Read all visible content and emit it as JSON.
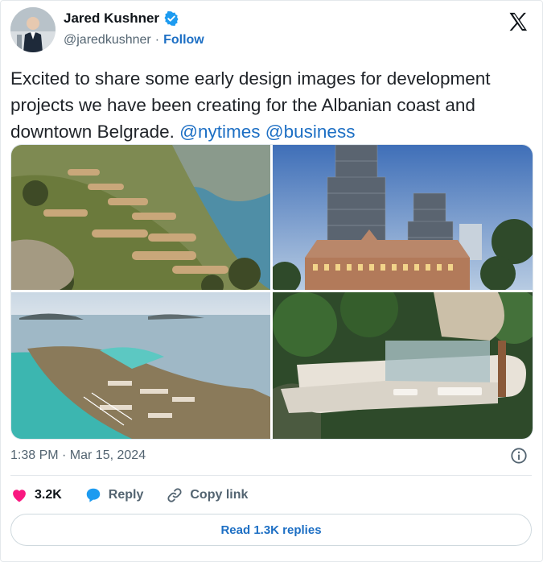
{
  "author": {
    "name": "Jared Kushner",
    "handle": "@jaredkushner",
    "separator": "·",
    "follow_label": "Follow",
    "verified_color": "#1d9bf0"
  },
  "tweet": {
    "text": "Excited to share some early design images for development projects we have been creating for the Albanian coast and downtown Belgrade.",
    "mentions": [
      "@nytimes",
      "@business"
    ]
  },
  "media": {
    "count": 4,
    "images": [
      {
        "subject": "terraced hillside resort on coast"
      },
      {
        "subject": "glass towers behind historic palace, Belgrade"
      },
      {
        "subject": "aerial view of island coast development"
      },
      {
        "subject": "modern cliffside villa with terraces"
      }
    ]
  },
  "meta": {
    "timestamp": "1:38 PM · Mar 15, 2024",
    "info_icon": "info-icon"
  },
  "actions": {
    "likes": "3.2K",
    "reply_label": "Reply",
    "copy_label": "Copy link",
    "like_color": "#f91880",
    "reply_color": "#1d6fc4"
  },
  "footer": {
    "read_replies_label": "Read 1.3K replies"
  }
}
